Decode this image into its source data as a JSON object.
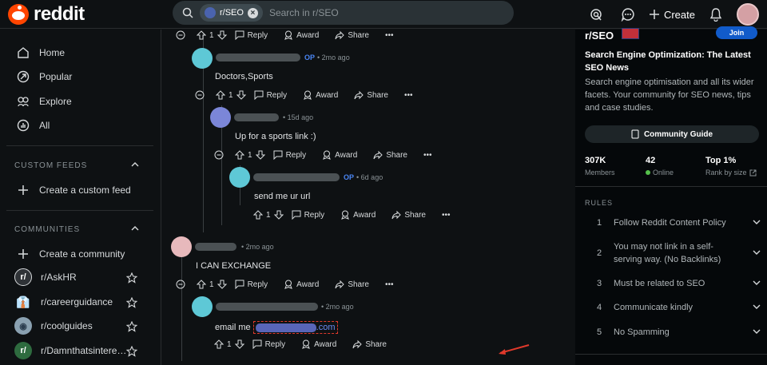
{
  "topbar": {
    "logo_text": "reddit",
    "search_chip": "r/SEO",
    "search_placeholder": "Search in r/SEO",
    "create_label": "Create"
  },
  "sidebar": {
    "nav": [
      {
        "label": "Home",
        "icon": "home-icon"
      },
      {
        "label": "Popular",
        "icon": "popular-icon"
      },
      {
        "label": "Explore",
        "icon": "explore-icon"
      },
      {
        "label": "All",
        "icon": "all-icon"
      }
    ],
    "custom_feeds_title": "CUSTOM FEEDS",
    "create_feed_label": "Create a custom feed",
    "communities_title": "COMMUNITIES",
    "create_community_label": "Create a community",
    "communities": [
      {
        "name": "r/AskHR",
        "color": "#2f3337",
        "glyph": "r/"
      },
      {
        "name": "r/careerguidance",
        "color": "#0e1113",
        "glyph": "👔"
      },
      {
        "name": "r/coolguides",
        "color": "#8aa1b1",
        "glyph": "◉"
      },
      {
        "name": "r/Damnthatsintere…",
        "color": "#2e6b3f",
        "glyph": "r/"
      }
    ]
  },
  "thread": {
    "actions": {
      "reply": "Reply",
      "award": "Award",
      "share": "Share",
      "more": "•••"
    },
    "comments": [
      {
        "vote": "1",
        "op": "",
        "time": "",
        "text": ""
      },
      {
        "vote": "1",
        "op": "OP",
        "time": "2mo ago",
        "text": "Doctors,Sports"
      },
      {
        "vote": "1",
        "op": "",
        "time": "15d ago",
        "text": "Up for a sports link :)"
      },
      {
        "vote": "1",
        "op": "OP",
        "time": "6d ago",
        "text": "send me ur url"
      },
      {
        "vote": "1",
        "op": "",
        "time": "2mo ago",
        "text": "I CAN EXCHANGE"
      },
      {
        "vote": "1",
        "op": "",
        "time": "2mo ago",
        "text_prefix": "email me",
        "text_suffix": ".com"
      }
    ]
  },
  "right": {
    "title": "r/SEO",
    "join_label": "Join",
    "headline": "Search Engine Optimization: The Latest SEO News",
    "description": "Search engine optimisation and all its wider facets. Your community for SEO news, tips and case studies.",
    "guide_label": "Community Guide",
    "stats": [
      {
        "value": "307K",
        "label": "Members"
      },
      {
        "value": "42",
        "label": "Online"
      },
      {
        "value": "Top 1%",
        "label": "Rank by size"
      }
    ],
    "rules_title": "RULES",
    "rules": [
      {
        "n": "1",
        "text": "Follow Reddit Content Policy"
      },
      {
        "n": "2",
        "text": "You may not link in a self-serving way. (No Backlinks)"
      },
      {
        "n": "3",
        "text": "Must be related to SEO"
      },
      {
        "n": "4",
        "text": "Communicate kindly"
      },
      {
        "n": "5",
        "text": "No Spamming"
      }
    ]
  },
  "colors": {
    "accent": "#ff4500",
    "join": "#115bca",
    "op": "#4a86f5",
    "annotation": "#e0392b"
  }
}
